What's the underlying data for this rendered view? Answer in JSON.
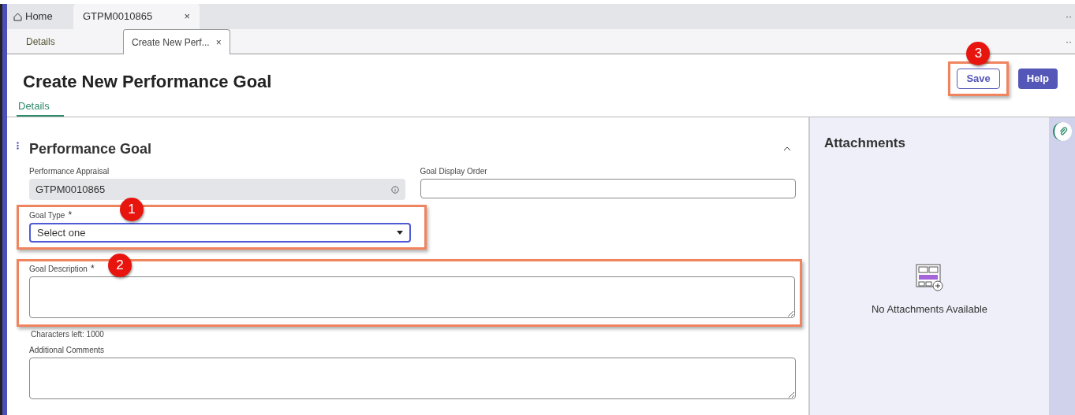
{
  "app_tabs": [
    {
      "label": "Home",
      "kind": "home",
      "selected": false
    },
    {
      "label": "GTPM0010865",
      "kind": "record",
      "selected": true,
      "close": "×"
    }
  ],
  "app_tabs_more": "··",
  "sub_tabs": [
    {
      "label": "Details",
      "selected": false
    },
    {
      "label": "Create New Perf...",
      "selected": true,
      "close": "×"
    }
  ],
  "sub_tabs_more": "··",
  "page_title": "Create New Performance Goal",
  "buttons": [
    {
      "label": "Save",
      "kind": "secondary",
      "callout": "3"
    },
    {
      "label": "Help",
      "kind": "primary"
    }
  ],
  "form_tabs": [
    {
      "label": "Details",
      "selected": true
    }
  ],
  "section": {
    "title": "Performance Goal",
    "expanded": true,
    "fields": [
      {
        "kind": "readonly",
        "label": "Performance Appraisal",
        "value": "GTPM0010865"
      },
      {
        "kind": "text",
        "label": "Goal Display Order"
      },
      {
        "kind": "select",
        "label": "Goal Type",
        "value": "Select one",
        "required_mark": "*",
        "callout": "1"
      },
      {
        "kind": "textarea",
        "label": "Goal Description",
        "required_mark": "*",
        "callout": "2",
        "counter": "Characters left: 1000"
      },
      {
        "kind": "textarea",
        "label": "Additional Comments"
      }
    ]
  },
  "attachments": {
    "title": "Attachments",
    "empty_text": "No Attachments Available"
  }
}
